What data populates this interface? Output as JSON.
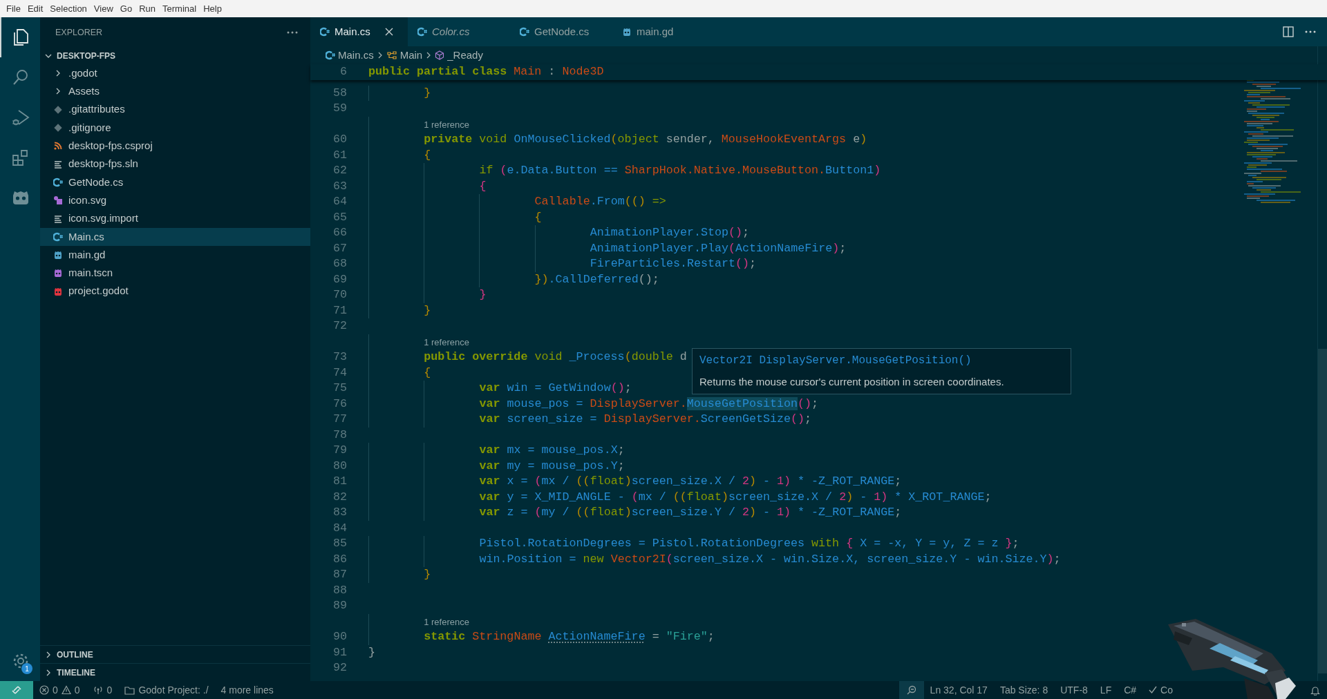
{
  "menu_bar": [
    "File",
    "Edit",
    "Selection",
    "View",
    "Go",
    "Run",
    "Terminal",
    "Help"
  ],
  "activity_bar": {
    "items": [
      {
        "kind": "explorer",
        "selected": true
      },
      {
        "kind": "search",
        "selected": false
      },
      {
        "kind": "debug",
        "selected": false
      },
      {
        "kind": "extensions",
        "selected": false
      },
      {
        "kind": "godot",
        "selected": false
      }
    ],
    "settings_badge": "1"
  },
  "sidebar": {
    "title": "EXPLORER",
    "folder": {
      "name": "DESKTOP-FPS",
      "expanded": true,
      "children": [
        {
          "name": ".godot",
          "kind": "folder",
          "expanded": false,
          "selected": false
        },
        {
          "name": "Assets",
          "kind": "folder",
          "expanded": false,
          "selected": false
        },
        {
          "name": ".gitattributes",
          "kind": "git",
          "selected": false
        },
        {
          "name": ".gitignore",
          "kind": "git",
          "selected": false
        },
        {
          "name": "desktop-fps.csproj",
          "kind": "rss",
          "selected": false
        },
        {
          "name": "desktop-fps.sln",
          "kind": "text",
          "selected": false
        },
        {
          "name": "GetNode.cs",
          "kind": "csharp",
          "selected": false
        },
        {
          "name": "icon.svg",
          "kind": "svg",
          "selected": false
        },
        {
          "name": "icon.svg.import",
          "kind": "text",
          "selected": false
        },
        {
          "name": "Main.cs",
          "kind": "csharp",
          "selected": true
        },
        {
          "name": "main.gd",
          "kind": "godot",
          "color": "#4fa3c9",
          "selected": false
        },
        {
          "name": "main.tscn",
          "kind": "godot",
          "color": "#a66ad6",
          "selected": false
        },
        {
          "name": "project.godot",
          "kind": "godot",
          "color": "#e0343f",
          "selected": false
        }
      ]
    },
    "sections": [
      {
        "name": "OUTLINE",
        "expanded": false
      },
      {
        "name": "TIMELINE",
        "expanded": false
      }
    ]
  },
  "editor": {
    "tabs": [
      {
        "label": "Main.cs",
        "kind": "csharp",
        "selected": true,
        "preview": false
      },
      {
        "label": "Color.cs",
        "kind": "csharp",
        "selected": false,
        "preview": true
      },
      {
        "label": "GetNode.cs",
        "kind": "csharp",
        "selected": false,
        "preview": false
      },
      {
        "label": "main.gd",
        "kind": "godot",
        "selected": false,
        "preview": false
      }
    ],
    "breadcrumbs": [
      {
        "label": "Main.cs",
        "kind": "csharp"
      },
      {
        "label": "Main",
        "kind": "class"
      },
      {
        "label": "_Ready",
        "kind": "method"
      }
    ],
    "sticky_line": {
      "number": "6",
      "tokens": [
        {
          "text": "public partial class ",
          "kind": "kw"
        },
        {
          "text": "Main",
          "kind": "type"
        },
        {
          "text": " : ",
          "kind": "plain"
        },
        {
          "text": "Node3D",
          "kind": "type"
        }
      ]
    },
    "lines": [
      {
        "kind": "code",
        "number": "58",
        "tokens": [
          {
            "text": "\t}",
            "kind": "b1"
          }
        ]
      },
      {
        "kind": "code",
        "number": "59"
      },
      {
        "kind": "lens",
        "text": "\t1 reference"
      },
      {
        "kind": "code",
        "number": "60",
        "tokens": [
          {
            "text": "\tprivate ",
            "kind": "kw"
          },
          {
            "text": "void ",
            "kind": "kw2"
          },
          {
            "text": "OnMouseClicked",
            "kind": "id"
          },
          {
            "text": "(",
            "kind": "b1"
          },
          {
            "text": "object ",
            "kind": "kw2"
          },
          {
            "text": "sender, ",
            "kind": "plain"
          },
          {
            "text": "MouseHookEventArgs ",
            "kind": "type"
          },
          {
            "text": "e",
            "kind": "plain"
          },
          {
            "text": ")",
            "kind": "b1"
          }
        ]
      },
      {
        "kind": "code",
        "number": "61",
        "tokens": [
          {
            "text": "\t{",
            "kind": "b1"
          }
        ]
      },
      {
        "kind": "code",
        "number": "62",
        "tokens": [
          {
            "text": "\t\tif ",
            "kind": "kw2"
          },
          {
            "text": "(",
            "kind": "b2"
          },
          {
            "text": "e.Data.Button == ",
            "kind": "id"
          },
          {
            "text": "SharpHook.Native.MouseButton.",
            "kind": "type"
          },
          {
            "text": "Button1",
            "kind": "id"
          },
          {
            "text": ")",
            "kind": "b2"
          }
        ]
      },
      {
        "kind": "code",
        "number": "63",
        "tokens": [
          {
            "text": "\t\t{",
            "kind": "b2"
          }
        ]
      },
      {
        "kind": "code",
        "number": "64",
        "tokens": [
          {
            "text": "\t\t\tCallable",
            "kind": "type"
          },
          {
            "text": ".From",
            "kind": "id"
          },
          {
            "text": "(() ",
            "kind": "b1"
          },
          {
            "text": "=>",
            "kind": "kw2"
          }
        ]
      },
      {
        "kind": "code",
        "number": "65",
        "tokens": [
          {
            "text": "\t\t\t{",
            "kind": "b1"
          }
        ]
      },
      {
        "kind": "code",
        "number": "66",
        "tokens": [
          {
            "text": "\t\t\t\tAnimationPlayer.Stop",
            "kind": "id"
          },
          {
            "text": "()",
            "kind": "b2"
          },
          {
            "text": ";",
            "kind": "plain"
          }
        ]
      },
      {
        "kind": "code",
        "number": "67",
        "tokens": [
          {
            "text": "\t\t\t\tAnimationPlayer.Play",
            "kind": "id"
          },
          {
            "text": "(",
            "kind": "b2"
          },
          {
            "text": "ActionNameFire",
            "kind": "id"
          },
          {
            "text": ")",
            "kind": "b2"
          },
          {
            "text": ";",
            "kind": "plain"
          }
        ]
      },
      {
        "kind": "code",
        "number": "68",
        "tokens": [
          {
            "text": "\t\t\t\tFireParticles.Restart",
            "kind": "id"
          },
          {
            "text": "()",
            "kind": "b2"
          },
          {
            "text": ";",
            "kind": "plain"
          }
        ]
      },
      {
        "kind": "code",
        "number": "69",
        "tokens": [
          {
            "text": "\t\t\t})",
            "kind": "b1"
          },
          {
            "text": ".CallDeferred",
            "kind": "id"
          },
          {
            "text": "();",
            "kind": "plain"
          }
        ]
      },
      {
        "kind": "code",
        "number": "70",
        "tokens": [
          {
            "text": "\t\t}",
            "kind": "b2"
          }
        ]
      },
      {
        "kind": "code",
        "number": "71",
        "tokens": [
          {
            "text": "\t}",
            "kind": "b1"
          }
        ]
      },
      {
        "kind": "code",
        "number": "72"
      },
      {
        "kind": "lens",
        "text": "\t1 reference"
      },
      {
        "kind": "code",
        "number": "73",
        "tokens": [
          {
            "text": "\tpublic override ",
            "kind": "kw"
          },
          {
            "text": "void ",
            "kind": "kw2"
          },
          {
            "text": "_Process",
            "kind": "id"
          },
          {
            "text": "(",
            "kind": "b1"
          },
          {
            "text": "double ",
            "kind": "kw2"
          },
          {
            "text": "d",
            "kind": "plain"
          }
        ]
      },
      {
        "kind": "code",
        "number": "74",
        "tokens": [
          {
            "text": "\t{",
            "kind": "b1"
          }
        ]
      },
      {
        "kind": "code",
        "number": "75",
        "tokens": [
          {
            "text": "\t\tvar ",
            "kind": "kw"
          },
          {
            "text": "win = GetWindow",
            "kind": "id"
          },
          {
            "text": "()",
            "kind": "b2"
          },
          {
            "text": ";",
            "kind": "plain"
          }
        ]
      },
      {
        "kind": "code",
        "number": "76",
        "tokens": [
          {
            "text": "\t\tvar ",
            "kind": "kw"
          },
          {
            "text": "mouse_pos = ",
            "kind": "id"
          },
          {
            "text": "DisplayServer.",
            "kind": "type"
          },
          {
            "text": "MouseGetPosition",
            "kind": "id",
            "highlighted": true
          },
          {
            "text": "()",
            "kind": "b2"
          },
          {
            "text": ";",
            "kind": "plain"
          }
        ]
      },
      {
        "kind": "code",
        "number": "77",
        "tokens": [
          {
            "text": "\t\tvar ",
            "kind": "kw"
          },
          {
            "text": "screen_size = ",
            "kind": "id"
          },
          {
            "text": "DisplayServer.",
            "kind": "type"
          },
          {
            "text": "ScreenGetSize",
            "kind": "id"
          },
          {
            "text": "()",
            "kind": "b2"
          },
          {
            "text": ";",
            "kind": "plain"
          }
        ]
      },
      {
        "kind": "code",
        "number": "78"
      },
      {
        "kind": "code",
        "number": "79",
        "tokens": [
          {
            "text": "\t\tvar ",
            "kind": "kw"
          },
          {
            "text": "mx = mouse_pos.X",
            "kind": "id"
          },
          {
            "text": ";",
            "kind": "plain"
          }
        ]
      },
      {
        "kind": "code",
        "number": "80",
        "tokens": [
          {
            "text": "\t\tvar ",
            "kind": "kw"
          },
          {
            "text": "my = mouse_pos.Y",
            "kind": "id"
          },
          {
            "text": ";",
            "kind": "plain"
          }
        ]
      },
      {
        "kind": "code",
        "number": "81",
        "tokens": [
          {
            "text": "\t\tvar ",
            "kind": "kw"
          },
          {
            "text": "x = ",
            "kind": "id"
          },
          {
            "text": "(",
            "kind": "b2"
          },
          {
            "text": "mx / ",
            "kind": "id"
          },
          {
            "text": "((",
            "kind": "b1"
          },
          {
            "text": "float",
            "kind": "kw2"
          },
          {
            "text": ")",
            "kind": "b1"
          },
          {
            "text": "screen_size.X / ",
            "kind": "id"
          },
          {
            "text": "2",
            "kind": "num"
          },
          {
            "text": ")",
            "kind": "b1"
          },
          {
            "text": " - ",
            "kind": "id"
          },
          {
            "text": "1",
            "kind": "num"
          },
          {
            "text": ")",
            "kind": "b2"
          },
          {
            "text": " * -Z_ROT_RANGE",
            "kind": "id"
          },
          {
            "text": ";",
            "kind": "plain"
          }
        ]
      },
      {
        "kind": "code",
        "number": "82",
        "tokens": [
          {
            "text": "\t\tvar ",
            "kind": "kw"
          },
          {
            "text": "y = X_MID_ANGLE - ",
            "kind": "id"
          },
          {
            "text": "(",
            "kind": "b2"
          },
          {
            "text": "mx / ",
            "kind": "id"
          },
          {
            "text": "((",
            "kind": "b1"
          },
          {
            "text": "float",
            "kind": "kw2"
          },
          {
            "text": ")",
            "kind": "b1"
          },
          {
            "text": "screen_size.X / ",
            "kind": "id"
          },
          {
            "text": "2",
            "kind": "num"
          },
          {
            "text": ")",
            "kind": "b1"
          },
          {
            "text": " - ",
            "kind": "id"
          },
          {
            "text": "1",
            "kind": "num"
          },
          {
            "text": ")",
            "kind": "b2"
          },
          {
            "text": " * X_ROT_RANGE",
            "kind": "id"
          },
          {
            "text": ";",
            "kind": "plain"
          }
        ]
      },
      {
        "kind": "code",
        "number": "83",
        "tokens": [
          {
            "text": "\t\tvar ",
            "kind": "kw"
          },
          {
            "text": "z = ",
            "kind": "id"
          },
          {
            "text": "(",
            "kind": "b2"
          },
          {
            "text": "my / ",
            "kind": "id"
          },
          {
            "text": "((",
            "kind": "b1"
          },
          {
            "text": "float",
            "kind": "kw2"
          },
          {
            "text": ")",
            "kind": "b1"
          },
          {
            "text": "screen_size.Y / ",
            "kind": "id"
          },
          {
            "text": "2",
            "kind": "num"
          },
          {
            "text": ")",
            "kind": "b1"
          },
          {
            "text": " - ",
            "kind": "id"
          },
          {
            "text": "1",
            "kind": "num"
          },
          {
            "text": ")",
            "kind": "b2"
          },
          {
            "text": " * -Z_ROT_RANGE",
            "kind": "id"
          },
          {
            "text": ";",
            "kind": "plain"
          }
        ]
      },
      {
        "kind": "code",
        "number": "84"
      },
      {
        "kind": "code",
        "number": "85",
        "tokens": [
          {
            "text": "\t\tPistol.RotationDegrees = Pistol.RotationDegrees ",
            "kind": "id"
          },
          {
            "text": "with ",
            "kind": "kw2"
          },
          {
            "text": "{",
            "kind": "b2"
          },
          {
            "text": " X = -x, Y = y, Z = z ",
            "kind": "id"
          },
          {
            "text": "}",
            "kind": "b2"
          },
          {
            "text": ";",
            "kind": "plain"
          }
        ]
      },
      {
        "kind": "code",
        "number": "86",
        "tokens": [
          {
            "text": "\t\twin.Position = ",
            "kind": "id"
          },
          {
            "text": "new ",
            "kind": "kw2"
          },
          {
            "text": "Vector2I",
            "kind": "type"
          },
          {
            "text": "(",
            "kind": "b2"
          },
          {
            "text": "screen_size.X - win.Size.X, screen_size.Y - win.Size.Y",
            "kind": "id"
          },
          {
            "text": ")",
            "kind": "b2"
          },
          {
            "text": ";",
            "kind": "plain"
          }
        ]
      },
      {
        "kind": "code",
        "number": "87",
        "tokens": [
          {
            "text": "\t}",
            "kind": "b1"
          }
        ]
      },
      {
        "kind": "code",
        "number": "88"
      },
      {
        "kind": "code",
        "number": "89"
      },
      {
        "kind": "lens",
        "text": "\t1 reference"
      },
      {
        "kind": "code",
        "number": "90",
        "tokens": [
          {
            "text": "\tstatic ",
            "kind": "kw"
          },
          {
            "text": "StringName ",
            "kind": "type"
          },
          {
            "text": "ActionNameFire",
            "kind": "id",
            "hint": true
          },
          {
            "text": " = ",
            "kind": "plain"
          },
          {
            "text": "\"Fire\"",
            "kind": "str"
          },
          {
            "text": ";",
            "kind": "plain"
          }
        ]
      },
      {
        "kind": "code",
        "number": "91",
        "tokens": [
          {
            "text": "}",
            "kind": "plain"
          }
        ]
      },
      {
        "kind": "code",
        "number": "92"
      }
    ],
    "hover": {
      "signature": "Vector2I DisplayServer.MouseGetPosition()",
      "description": "Returns the mouse cursor's current position in screen coordinates."
    }
  },
  "status_bar": {
    "errors": "0",
    "warnings": "0",
    "ports": "0",
    "project": "Godot Project: ./",
    "more": "4 more lines",
    "position": "Ln 32, Col 17",
    "tab_size": "Tab Size: 8",
    "encoding": "UTF-8",
    "eol": "LF",
    "language": "C#",
    "formatter": "Co"
  },
  "overlay": {
    "kind": "picture"
  }
}
